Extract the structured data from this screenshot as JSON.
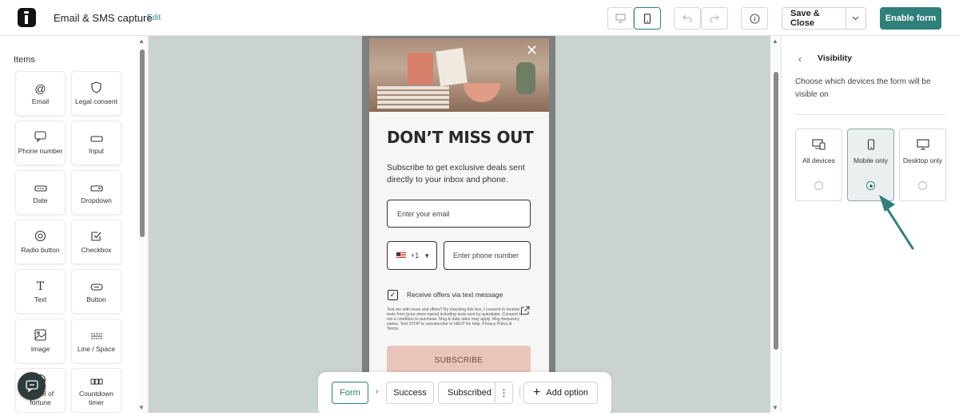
{
  "app": {
    "title": "Email & SMS capture",
    "edit_label": "Edit"
  },
  "toolbar": {
    "desktop_icon": "monitor-icon",
    "mobile_icon": "mobile-icon",
    "undo_icon": "undo-icon",
    "redo_icon": "redo-icon",
    "info_icon": "info-icon",
    "save_label": "Save & Close",
    "enable_label": "Enable form",
    "accent": "#2f7f7a"
  },
  "left": {
    "heading": "Items",
    "items": [
      {
        "label": "Email",
        "icon": "at-icon"
      },
      {
        "label": "Legal consent",
        "icon": "shield-icon"
      },
      {
        "label": "Phone number",
        "icon": "chat-icon"
      },
      {
        "label": "Input",
        "icon": "input-icon"
      },
      {
        "label": "Date",
        "icon": "date-icon"
      },
      {
        "label": "Dropdown",
        "icon": "dropdown-icon"
      },
      {
        "label": "Radio button",
        "icon": "radio-icon"
      },
      {
        "label": "Checkbox",
        "icon": "checkbox-icon"
      },
      {
        "label": "Text",
        "icon": "text-icon"
      },
      {
        "label": "Button",
        "icon": "button-icon"
      },
      {
        "label": "Image",
        "icon": "image-icon"
      },
      {
        "label": "Line / Space",
        "icon": "line-icon"
      },
      {
        "label": "Wheel of fortune",
        "icon": "wheel-icon"
      },
      {
        "label": "Countdown timer",
        "icon": "countdown-icon"
      }
    ]
  },
  "form": {
    "headline": "DON’T MISS OUT",
    "subtitle": "Subscribe to get exclusive deals sent directly to your inbox and phone.",
    "email_placeholder": "Enter your email",
    "country_code": "+1",
    "phone_placeholder": "Enter phone number",
    "sms_checkbox_label": "Receive offers via text message",
    "legal_text": "Text me with news and offers? By checking this box, I consent to receive texts from [your-store-name] including texts sent by autodialer. Consent is not a condition to purchase. Msg & data rates may apply. Msg frequency varies. Text STOP to unsubscribe or HELP for help. Privacy Policy & Terms.",
    "subscribe_label": "SUBSCRIBE"
  },
  "flow": {
    "steps": [
      "Form",
      "Success",
      "Subscribed"
    ],
    "add_label": "Add option"
  },
  "right": {
    "heading": "Visibility",
    "description": "Choose which devices the form will be visible on",
    "options": [
      {
        "label": "All devices",
        "icon": "devices-icon",
        "selected": false
      },
      {
        "label": "Mobile only",
        "icon": "mobile-icon",
        "selected": true
      },
      {
        "label": "Desktop only",
        "icon": "monitor-icon",
        "selected": false
      }
    ]
  }
}
